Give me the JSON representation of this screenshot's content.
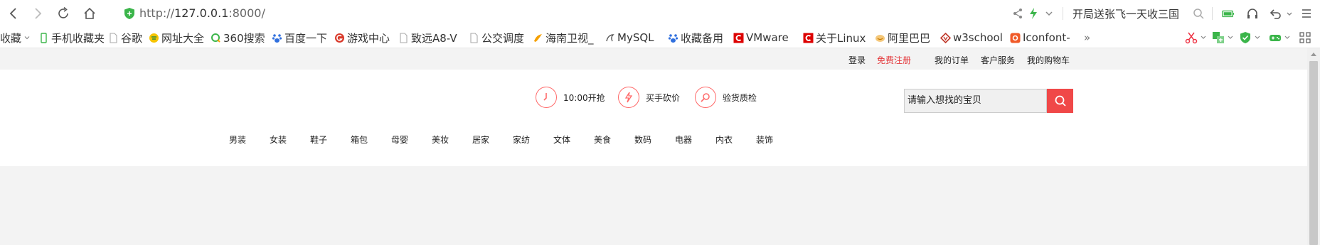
{
  "browser": {
    "url_prefix": "http://",
    "url_host": "127.0.0.1",
    "url_port": ":8000/",
    "hot_search": "开局送张飞一天收三国",
    "bookmarks": [
      {
        "label": "收藏",
        "icon": "favorites-dropdown-icon"
      },
      {
        "label": "手机收藏夹",
        "icon": "phone-icon"
      },
      {
        "label": "谷歌",
        "icon": "page-icon"
      },
      {
        "label": "网址大全",
        "icon": "url-directory-icon"
      },
      {
        "label": "360搜索",
        "icon": "search-360-icon"
      },
      {
        "label": "百度一下",
        "icon": "baidu-paw-icon"
      },
      {
        "label": "游戏中心",
        "icon": "game-center-icon"
      },
      {
        "label": "致远A8-V",
        "icon": "page-icon"
      },
      {
        "label": "公交调度",
        "icon": "page-icon"
      },
      {
        "label": "海南卫视_",
        "icon": "tv-icon"
      },
      {
        "label": "MySQL",
        "icon": "mysql-dolphin-icon"
      },
      {
        "label": "收藏备用",
        "icon": "baidu-paw-icon"
      },
      {
        "label": "VMware",
        "icon": "csdn-icon"
      },
      {
        "label": "关于Linux",
        "icon": "csdn-icon"
      },
      {
        "label": "阿里巴巴",
        "icon": "alibaba-icon"
      },
      {
        "label": "w3school",
        "icon": "w3school-icon"
      },
      {
        "label": "Iconfont-",
        "icon": "iconfont-icon"
      }
    ],
    "more": "»"
  },
  "site": {
    "toplinks": {
      "login": "登录",
      "register": "免费注册",
      "orders": "我的订单",
      "service": "客户服务",
      "cart": "我的购物车"
    },
    "features": [
      {
        "label": "10:00开抢",
        "icon": "clock-icon"
      },
      {
        "label": "买手砍价",
        "icon": "lightning-icon"
      },
      {
        "label": "验货质检",
        "icon": "magnifier-icon"
      }
    ],
    "search": {
      "placeholder": "请输入想找的宝贝"
    },
    "categories": [
      "男装",
      "女装",
      "鞋子",
      "箱包",
      "母婴",
      "美妆",
      "居家",
      "家纺",
      "文体",
      "美食",
      "数码",
      "电器",
      "内衣",
      "装饰"
    ]
  },
  "colors": {
    "accent_red": "#f04848",
    "link_red": "#e4393c",
    "feature_ring": "#ff6a6a"
  }
}
